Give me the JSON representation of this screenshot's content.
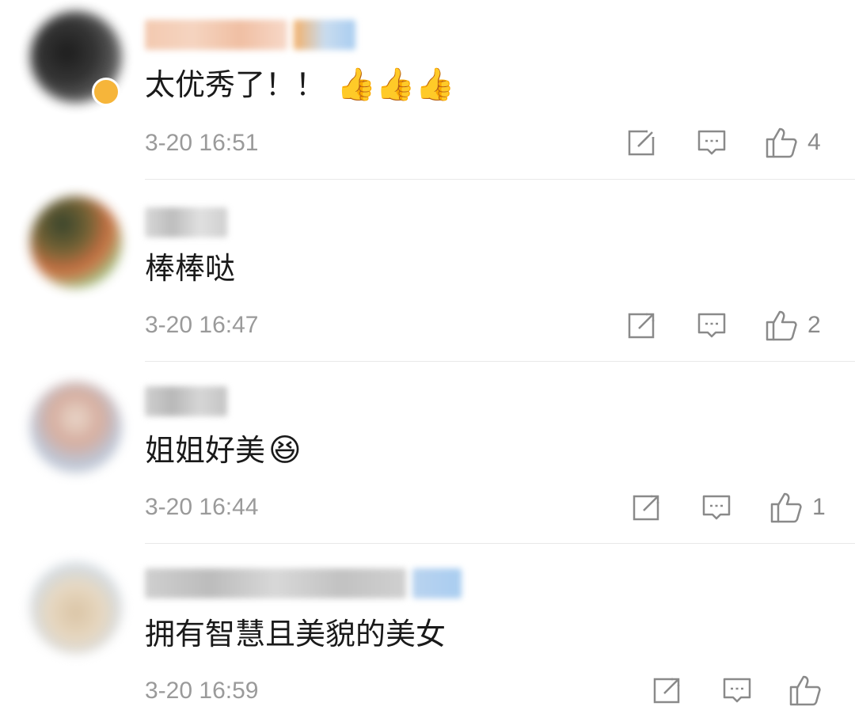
{
  "comments": [
    {
      "text": "太优秀了！！",
      "emoji": "👍👍👍",
      "emoji_name": "thumbs-up",
      "time": "3-20 16:51",
      "likes": "4"
    },
    {
      "text": "棒棒哒",
      "emoji": "",
      "time": "3-20 16:47",
      "likes": "2"
    },
    {
      "text": "姐姐好美",
      "emoji": "😆",
      "emoji_name": "excited-face",
      "time": "3-20 16:44",
      "likes": "1"
    },
    {
      "text": "拥有智慧且美貌的美女",
      "emoji": "",
      "time": "3-20 16:59",
      "likes": ""
    }
  ],
  "colors": {
    "text": "#1a1a1a",
    "meta": "#9a9a9a",
    "icon": "#8a8a8a",
    "divider": "#e8e8e8",
    "vip_badge": "#f6b53a"
  },
  "icons": {
    "repost": "repost-icon",
    "reply": "comment-icon",
    "like": "like-icon"
  }
}
